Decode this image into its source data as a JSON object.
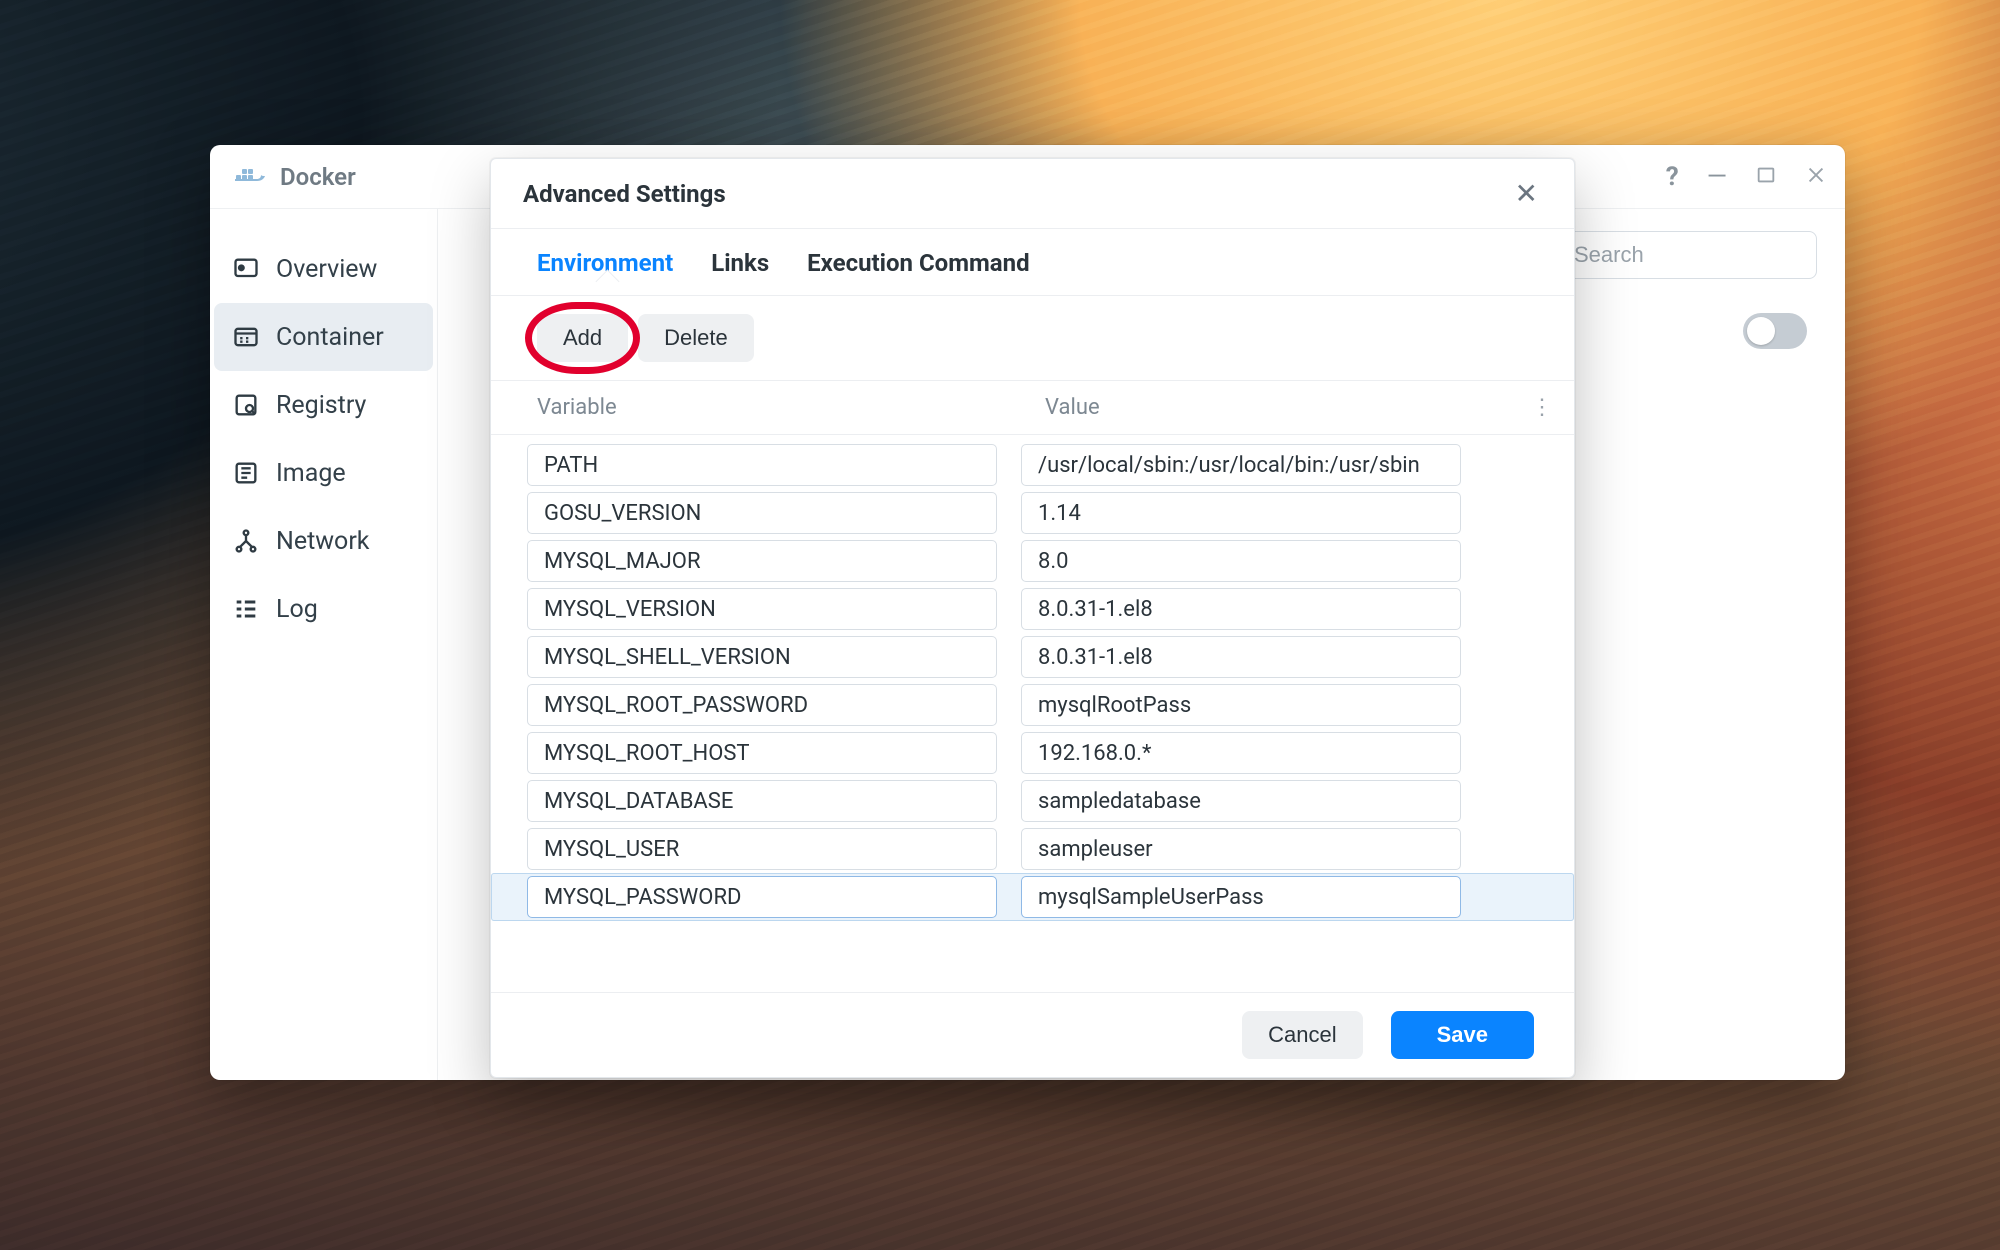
{
  "window": {
    "title": "Docker",
    "search_placeholder": "Search"
  },
  "sidebar": {
    "items": [
      {
        "id": "overview",
        "label": "Overview"
      },
      {
        "id": "container",
        "label": "Container"
      },
      {
        "id": "registry",
        "label": "Registry"
      },
      {
        "id": "image",
        "label": "Image"
      },
      {
        "id": "network",
        "label": "Network"
      },
      {
        "id": "log",
        "label": "Log"
      }
    ],
    "active": "container"
  },
  "modal": {
    "title": "Advanced Settings",
    "tabs": [
      {
        "id": "environment",
        "label": "Environment"
      },
      {
        "id": "links",
        "label": "Links"
      },
      {
        "id": "exec",
        "label": "Execution Command"
      }
    ],
    "active_tab": "environment",
    "toolbar": {
      "add_label": "Add",
      "delete_label": "Delete"
    },
    "columns": {
      "variable": "Variable",
      "value": "Value"
    },
    "env": [
      {
        "variable": "PATH",
        "value": "/usr/local/sbin:/usr/local/bin:/usr/sbin"
      },
      {
        "variable": "GOSU_VERSION",
        "value": "1.14"
      },
      {
        "variable": "MYSQL_MAJOR",
        "value": "8.0"
      },
      {
        "variable": "MYSQL_VERSION",
        "value": "8.0.31-1.el8"
      },
      {
        "variable": "MYSQL_SHELL_VERSION",
        "value": "8.0.31-1.el8"
      },
      {
        "variable": "MYSQL_ROOT_PASSWORD",
        "value": "mysqlRootPass"
      },
      {
        "variable": "MYSQL_ROOT_HOST",
        "value": "192.168.0.*"
      },
      {
        "variable": "MYSQL_DATABASE",
        "value": "sampledatabase"
      },
      {
        "variable": "MYSQL_USER",
        "value": "sampleuser"
      },
      {
        "variable": "MYSQL_PASSWORD",
        "value": "mysqlSampleUserPass"
      }
    ],
    "selected_row": 9,
    "footer": {
      "cancel_label": "Cancel",
      "save_label": "Save"
    }
  },
  "annotation": {
    "highlight": "add-button"
  }
}
